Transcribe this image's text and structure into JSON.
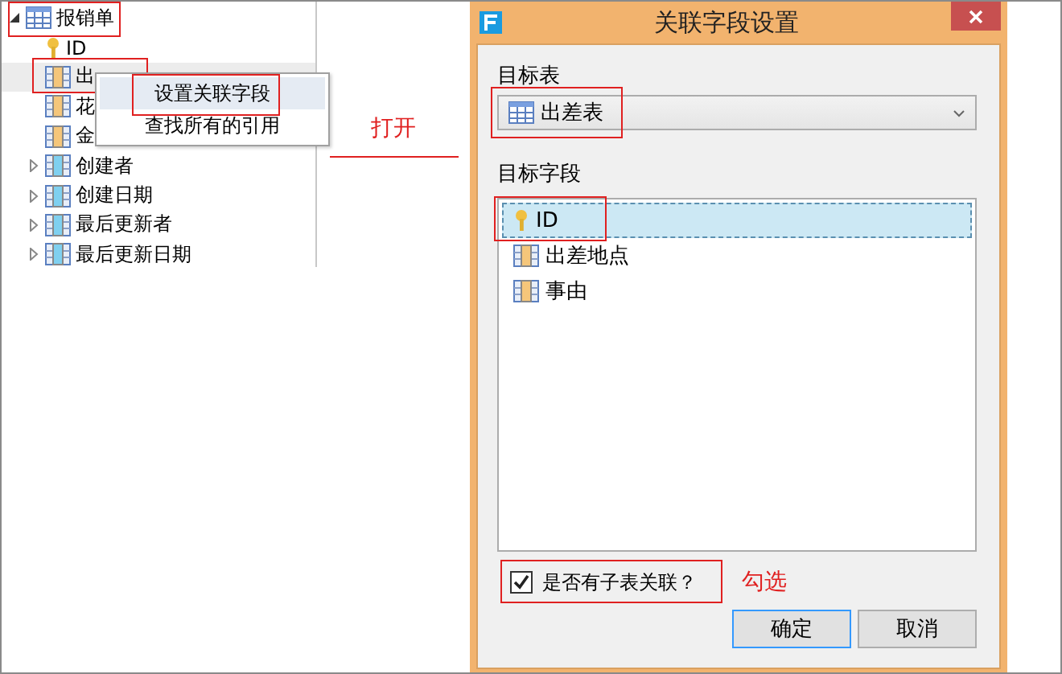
{
  "tree": {
    "label": "报销单",
    "expanded": true,
    "children": [
      {
        "label": "ID",
        "kind": "key"
      },
      {
        "label": "出",
        "kind": "field",
        "selected": true
      },
      {
        "label": "花",
        "kind": "field",
        "selected": false
      },
      {
        "label": "金",
        "kind": "field",
        "selected": false
      },
      {
        "label": "创建者",
        "kind": "system",
        "expanded": false
      },
      {
        "label": "创建日期",
        "kind": "system",
        "expanded": false
      },
      {
        "label": "最后更新者",
        "kind": "system",
        "expanded": false
      },
      {
        "label": "最后更新日期",
        "kind": "system",
        "expanded": false
      }
    ]
  },
  "context_menu": {
    "items": [
      {
        "label": "设置关联字段",
        "selected": true
      },
      {
        "label": "查找所有的引用",
        "selected": false
      }
    ]
  },
  "open_note": "打开",
  "dialog": {
    "title": "关联字段设置",
    "target_table_label": "目标表",
    "target_table": "出差表",
    "target_field_label": "目标字段",
    "fields": [
      {
        "label": "ID",
        "kind": "key",
        "selected": true
      },
      {
        "label": "出差地点",
        "kind": "field",
        "selected": false
      },
      {
        "label": "事由",
        "kind": "field",
        "selected": false
      }
    ],
    "subtable": {
      "label": "是否有子表关联？",
      "checked": true
    },
    "check_note": "勾选",
    "buttons": [
      {
        "label": "确定",
        "default": true
      },
      {
        "label": "取消",
        "default": false
      }
    ]
  }
}
